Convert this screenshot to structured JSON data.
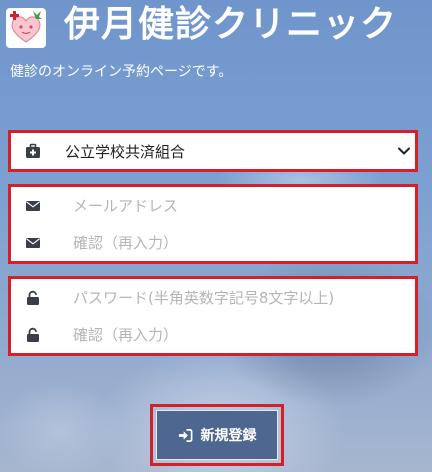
{
  "header": {
    "title": "伊月健診クリニック",
    "subtitle": "健診のオンライン予約ページです。",
    "logo_icon": "clinic-heart-logo-icon"
  },
  "form": {
    "insurance": {
      "selected": "公立学校共済組合",
      "icon": "medical-kit-icon"
    },
    "email": {
      "placeholder": "メールアドレス",
      "icon": "envelope-icon"
    },
    "email_confirm": {
      "placeholder": "確認（再入力）",
      "icon": "envelope-icon"
    },
    "password": {
      "placeholder": "パスワード(半角英数字記号8文字以上)",
      "icon": "unlock-icon"
    },
    "password_confirm": {
      "placeholder": "確認（再入力）",
      "icon": "unlock-icon"
    },
    "register_button": {
      "label": "新規登録",
      "icon": "sign-in-icon"
    }
  },
  "colors": {
    "highlight_border": "#d4202a",
    "button_bg": "#4d6790",
    "icon": "#3a3f47"
  }
}
